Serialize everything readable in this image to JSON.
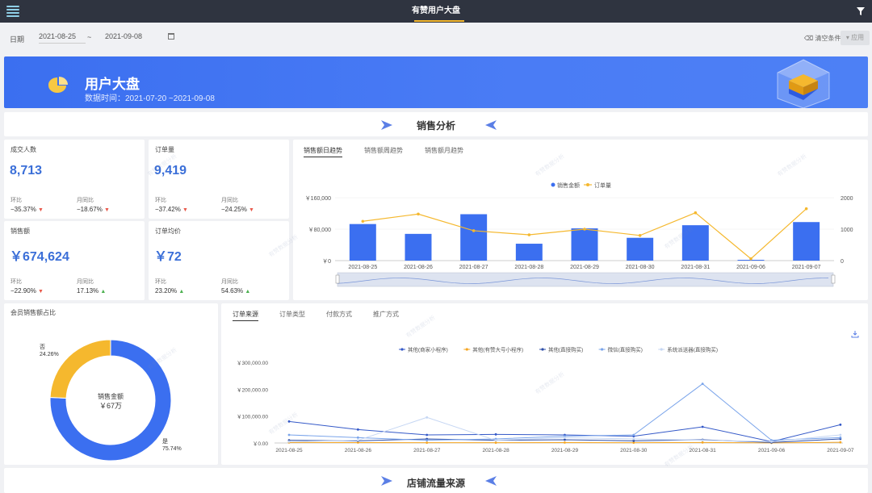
{
  "header": {
    "title": "有赞用户大盘"
  },
  "filters": {
    "label": "日期",
    "start_date": "2021-08-25",
    "separator": "~",
    "end_date": "2021-09-08",
    "clear_label": "清空条件",
    "apply_label": "应用"
  },
  "banner": {
    "title": "用户大盘",
    "subtitle": "数据时间：2021-07-20 ~2021-09-08"
  },
  "sections": {
    "sales": "销售分析",
    "traffic": "店铺流量来源"
  },
  "kpis": [
    {
      "title": "成交人数",
      "value": "8,713",
      "m1_label": "环比",
      "m1_value": "−35.37%",
      "m1_dir": "down",
      "m2_label": "月同比",
      "m2_value": "−18.67%",
      "m2_dir": "down"
    },
    {
      "title": "订单量",
      "value": "9,419",
      "m1_label": "环比",
      "m1_value": "−37.42%",
      "m1_dir": "down",
      "m2_label": "月同比",
      "m2_value": "−24.25%",
      "m2_dir": "down"
    },
    {
      "title": "销售额",
      "value": "￥674,624",
      "m1_label": "环比",
      "m1_value": "−22.90%",
      "m1_dir": "down",
      "m2_label": "月同比",
      "m2_value": "17.13%",
      "m2_dir": "up"
    },
    {
      "title": "订单均价",
      "value": "￥72",
      "m1_label": "环比",
      "m1_value": "23.20%",
      "m1_dir": "up",
      "m2_label": "月同比",
      "m2_value": "54.63%",
      "m2_dir": "up"
    }
  ],
  "trend_tabs": [
    "销售额日趋势",
    "销售额周趋势",
    "销售额月趋势"
  ],
  "member_title": "会员销售额占比",
  "source_tabs": [
    "订单来源",
    "订单类型",
    "付款方式",
    "推广方式"
  ],
  "watermark": "有赞数据分析",
  "icons": {
    "menu": "menu-icon",
    "filter": "filter-icon",
    "calendar": "calendar-icon",
    "eraser": "eraser-icon",
    "download": "download-icon"
  },
  "colors": {
    "accent": "#3b6ff0",
    "orange": "#f5b82e",
    "down": "#e8584a",
    "up": "#4cb050"
  },
  "chart_data": [
    {
      "type": "bar",
      "legend": [
        "销售金额",
        "订单量"
      ],
      "categories": [
        "2021-08-25",
        "2021-08-26",
        "2021-08-27",
        "2021-08-28",
        "2021-08-29",
        "2021-08-30",
        "2021-08-31",
        "2021-09-06",
        "2021-09-07"
      ],
      "series": [
        {
          "name": "销售金额",
          "type": "bar",
          "axis": "left",
          "values": [
            93000,
            68000,
            118000,
            43000,
            82000,
            58000,
            90000,
            2000,
            98000
          ]
        },
        {
          "name": "订单量",
          "type": "line",
          "axis": "right",
          "values": [
            1250,
            1480,
            950,
            820,
            1000,
            800,
            1520,
            60,
            1650
          ]
        }
      ],
      "y_left_ticks": [
        "￥0",
        "￥80,000",
        "￥160,000"
      ],
      "y_left_max": 160000,
      "y_right_ticks": [
        "0",
        "1000",
        "2000"
      ],
      "y_right_max": 2000
    },
    {
      "type": "pie",
      "center_label": "销售金额",
      "center_value": "￥67万",
      "slices": [
        {
          "name": "否",
          "label": "24.26%",
          "value": 24.26,
          "color": "#f5b82e"
        },
        {
          "name": "是",
          "label": "75.74%",
          "value": 75.74,
          "color": "#3b6ff0"
        }
      ]
    },
    {
      "type": "line",
      "legend": [
        "其他(商家小程序)",
        "其他(有赞大号小程序)",
        "其他(直接购买)",
        "微信(直接购买)",
        "系统派送器(直接购买)"
      ],
      "categories": [
        "2021-08-25",
        "2021-08-26",
        "2021-08-27",
        "2021-08-28",
        "2021-08-29",
        "2021-08-30",
        "2021-08-31",
        "2021-09-06",
        "2021-09-07"
      ],
      "series": [
        {
          "name": "其他(商家小程序)",
          "color": "#3459c8",
          "values": [
            80000,
            50000,
            30000,
            32000,
            30000,
            25000,
            60000,
            5000,
            68000
          ]
        },
        {
          "name": "其他(有赞大号小程序)",
          "color": "#f5a623",
          "values": [
            2000,
            1500,
            1000,
            1200,
            1500,
            1000,
            2000,
            500,
            2500
          ]
        },
        {
          "name": "其他(直接购买)",
          "color": "#2e4fa8",
          "values": [
            10000,
            8000,
            15000,
            10000,
            12000,
            8000,
            12000,
            2000,
            15000
          ]
        },
        {
          "name": "微信(直接购买)",
          "color": "#7aa4ea",
          "values": [
            30000,
            20000,
            10000,
            15000,
            25000,
            30000,
            220000,
            10000,
            20000
          ]
        },
        {
          "name": "系统派送器(直接购买)",
          "color": "#c5d6f3",
          "values": [
            5000,
            10000,
            95000,
            10000,
            20000,
            15000,
            10000,
            5000,
            30000
          ]
        }
      ],
      "y_ticks": [
        "￥0.00",
        "￥100,000.00",
        "￥200,000.00",
        "￥300,000.00"
      ],
      "y_max": 300000
    }
  ]
}
